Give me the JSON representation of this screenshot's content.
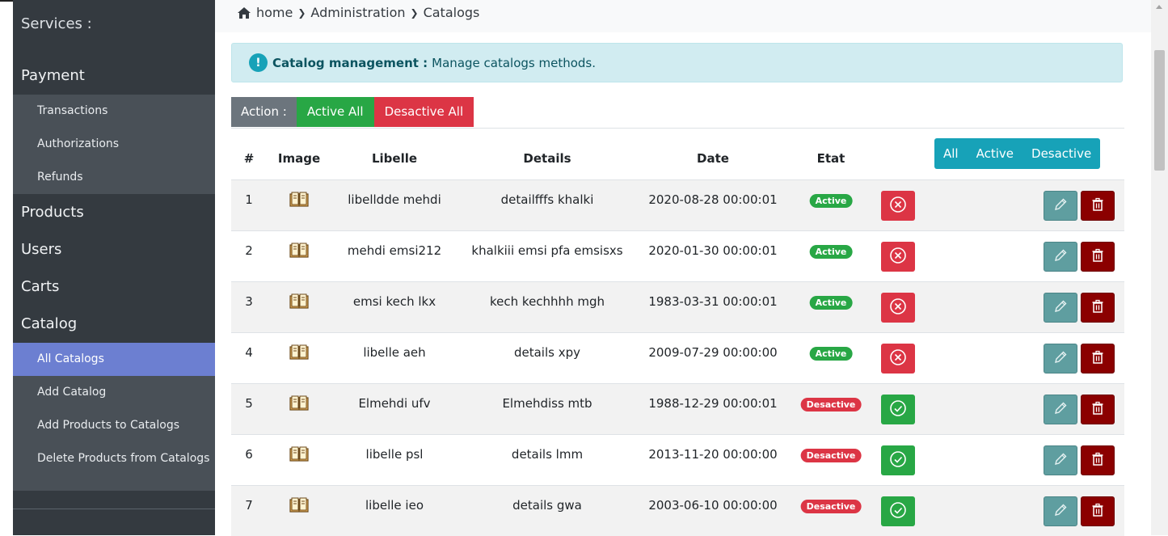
{
  "sidebar": {
    "services_label": "Services :",
    "payment_label": "Payment",
    "payment_items": [
      "Transactions",
      "Authorizations",
      "Refunds"
    ],
    "products_label": "Products",
    "users_label": "Users",
    "carts_label": "Carts",
    "catalog_label": "Catalog",
    "catalog_items": [
      "All Catalogs",
      "Add Catalog",
      "Add Products to Catalogs",
      "Delete Products from Catalogs"
    ],
    "active_item": "All Catalogs"
  },
  "breadcrumb": [
    "home",
    "Administration",
    "Catalogs"
  ],
  "alert": {
    "title": "Catalog management :",
    "text": "Manage catalogs methods."
  },
  "actions": {
    "label": "Action :",
    "active_all": "Active All",
    "desactive_all": "Desactive All"
  },
  "filter": [
    "All",
    "Active",
    "Desactive"
  ],
  "table": {
    "headers": [
      "#",
      "Image",
      "Libelle",
      "Details",
      "Date",
      "Etat"
    ],
    "rows": [
      {
        "id": "1",
        "libelle": "libelldde mehdi",
        "details": "detailfffs khalki",
        "date": "2020-08-28 00:00:01",
        "etat": "Active"
      },
      {
        "id": "2",
        "libelle": "mehdi emsi212",
        "details": "khalkiii emsi pfa emsisxs",
        "date": "2020-01-30 00:00:01",
        "etat": "Active"
      },
      {
        "id": "3",
        "libelle": "emsi kech lkx",
        "details": "kech kechhhh mgh",
        "date": "1983-03-31 00:00:01",
        "etat": "Active"
      },
      {
        "id": "4",
        "libelle": "libelle aeh",
        "details": "details xpy",
        "date": "2009-07-29 00:00:00",
        "etat": "Active"
      },
      {
        "id": "5",
        "libelle": "Elmehdi ufv",
        "details": "Elmehdiss mtb",
        "date": "1988-12-29 00:00:01",
        "etat": "Desactive"
      },
      {
        "id": "6",
        "libelle": "libelle psl",
        "details": "details lmm",
        "date": "2013-11-20 00:00:00",
        "etat": "Desactive"
      },
      {
        "id": "7",
        "libelle": "libelle ieo",
        "details": "details gwa",
        "date": "2003-06-10 00:00:00",
        "etat": "Desactive"
      }
    ]
  },
  "colors": {
    "sidebar_bg": "#343a40",
    "sidebar_sub_bg": "#495057",
    "sidebar_active": "#6c7fd1",
    "info": "#17a2b8",
    "success": "#28a745",
    "danger": "#dc3545",
    "edit": "#5f9ea0",
    "delete": "#8b0000"
  }
}
